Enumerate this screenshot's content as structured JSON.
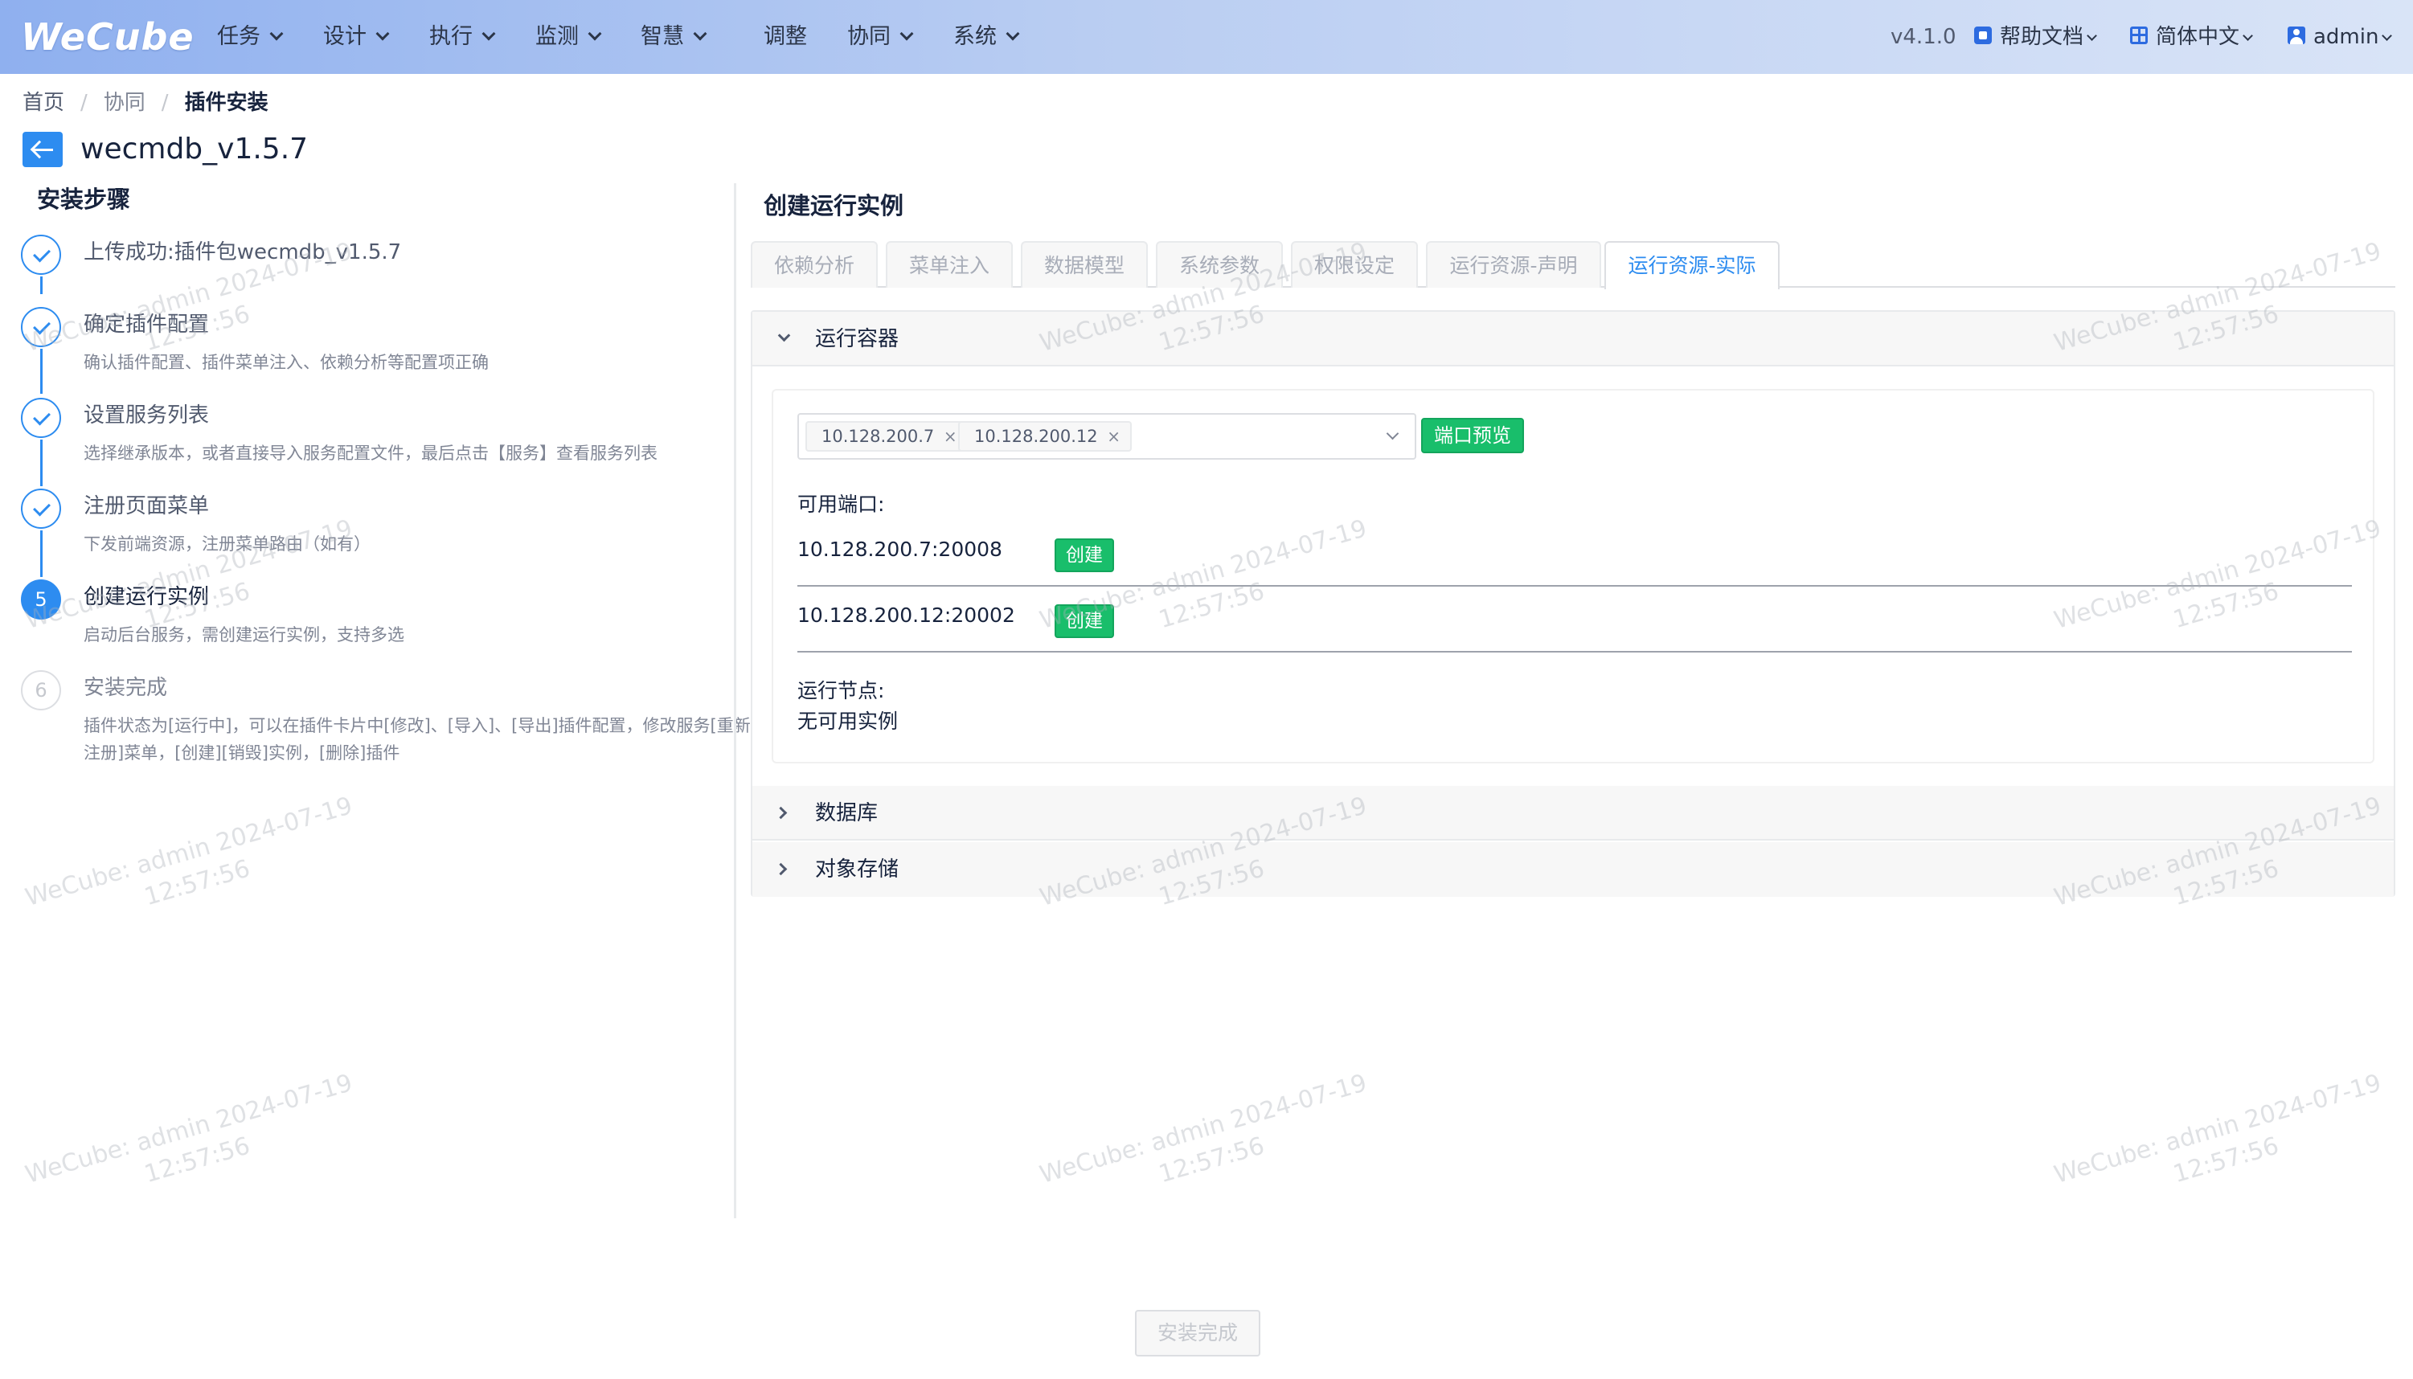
{
  "header": {
    "logo": "WeCube",
    "nav": [
      {
        "label": "任务",
        "dropdown": true
      },
      {
        "label": "设计",
        "dropdown": true
      },
      {
        "label": "执行",
        "dropdown": true
      },
      {
        "label": "监测",
        "dropdown": true
      },
      {
        "label": "智慧",
        "dropdown": true
      },
      {
        "label": "调整",
        "dropdown": false
      },
      {
        "label": "协同",
        "dropdown": true
      },
      {
        "label": "系统",
        "dropdown": true
      }
    ],
    "version": "v4.1.0",
    "help": "帮助文档",
    "language": "简体中文",
    "user": "admin",
    "accent_color": "#2d6be0"
  },
  "breadcrumb": [
    "首页",
    "协同",
    "插件安装"
  ],
  "plugin_title": "wecmdb_v1.5.7",
  "steps_panel": {
    "title": "安装步骤",
    "steps": [
      {
        "status": "done",
        "number": "1",
        "title": "上传成功:插件包wecmdb_v1.5.7",
        "desc": ""
      },
      {
        "status": "done",
        "number": "2",
        "title": "确定插件配置",
        "desc": "确认插件配置、插件菜单注入、依赖分析等配置项正确"
      },
      {
        "status": "done",
        "number": "3",
        "title": "设置服务列表",
        "desc": "选择继承版本，或者直接导入服务配置文件，最后点击【服务】查看服务列表"
      },
      {
        "status": "done",
        "number": "4",
        "title": "注册页面菜单",
        "desc": "下发前端资源，注册菜单路由（如有）"
      },
      {
        "status": "active",
        "number": "5",
        "title": "创建运行实例",
        "desc": "启动后台服务，需创建运行实例，支持多选"
      },
      {
        "status": "wait",
        "number": "6",
        "title": "安装完成",
        "desc": "插件状态为[运行中]，可以在插件卡片中[修改]、[导入]、[导出]插件配置，修改服务[重新注册]菜单，[创建][销毁]实例，[删除]插件"
      }
    ]
  },
  "main": {
    "title": "创建运行实例",
    "tabs": [
      {
        "label": "依赖分析",
        "active": false
      },
      {
        "label": "菜单注入",
        "active": false
      },
      {
        "label": "数据模型",
        "active": false
      },
      {
        "label": "系统参数",
        "active": false
      },
      {
        "label": "权限设定",
        "active": false
      },
      {
        "label": "运行资源-声明",
        "active": false
      },
      {
        "label": "运行资源-实际",
        "active": true
      }
    ],
    "panels": {
      "container": {
        "label": "运行容器",
        "selected_hosts": [
          "10.128.200.7",
          "10.128.200.12"
        ],
        "port_preview_label": "端口预览",
        "available_ports_label": "可用端口:",
        "ports": [
          {
            "address": "10.128.200.7:20008",
            "action": "创建"
          },
          {
            "address": "10.128.200.12:20002",
            "action": "创建"
          }
        ],
        "run_nodes_label": "运行节点:",
        "run_nodes_value": "无可用实例"
      },
      "database": {
        "label": "数据库"
      },
      "object_storage": {
        "label": "对象存储"
      }
    },
    "finish_label": "安装完成"
  },
  "watermark": {
    "line1": "WeCube: admin 2024-07-19",
    "line2": "12:57:56"
  },
  "icons": {
    "back": "arrow-left-icon",
    "help": "book-icon",
    "language": "globe-grid-icon",
    "user": "user-icon",
    "step_done": "check-icon",
    "remove_chip": "close-icon",
    "expand": "chevron-down-icon",
    "collapse": "chevron-right-icon"
  },
  "colors": {
    "primary": "#2d8cf0",
    "success": "#19be6b",
    "disabled": "#c5c8ce"
  }
}
